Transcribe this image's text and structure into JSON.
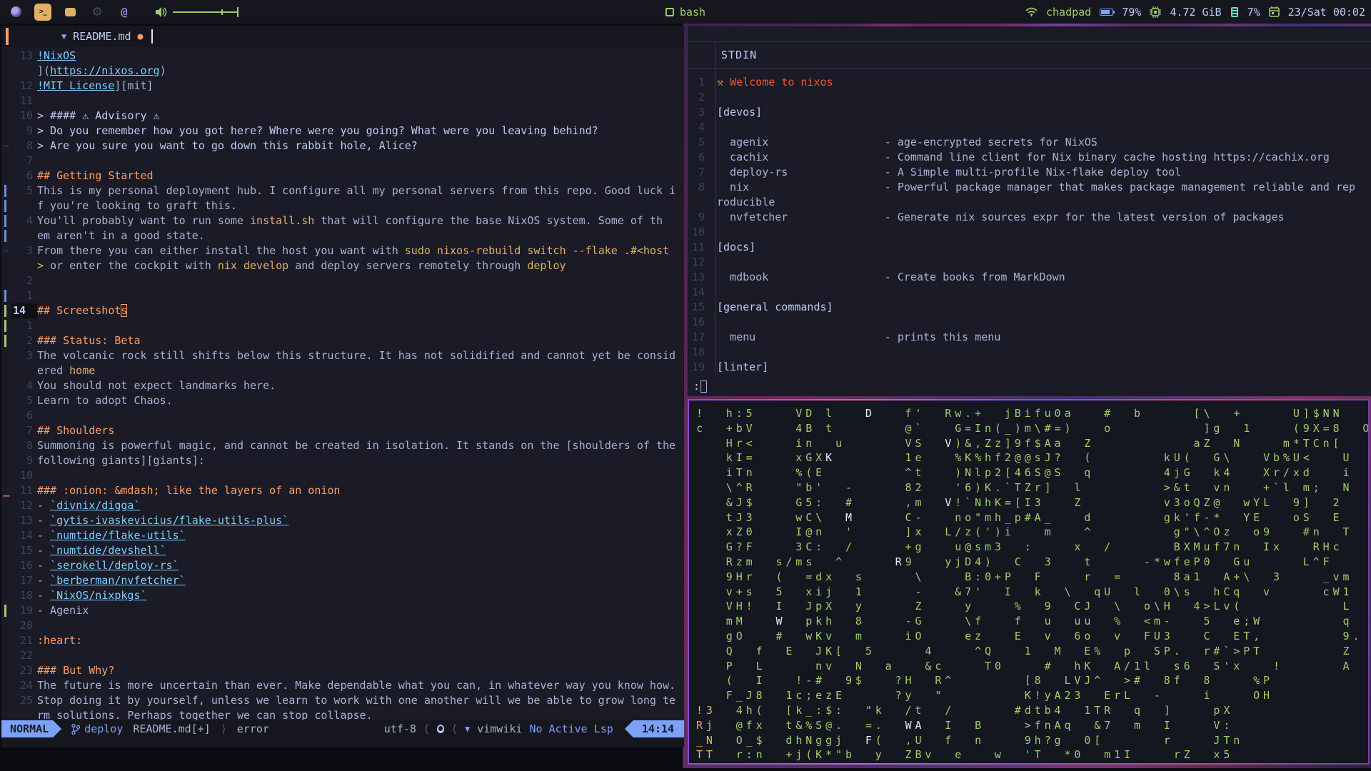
{
  "colors": {
    "bg": "#1a1b26",
    "bg_dark": "#16161e",
    "fg": "#a9b1d6",
    "fg_bright": "#c0caf5",
    "dim": "#3b4261",
    "blue": "#7aa2f7",
    "cyan": "#7dcfff",
    "green": "#9ece6a",
    "orange": "#ff9e64",
    "yellow": "#e0af68",
    "red": "#f7768e",
    "matrix_green": "#9ece6a"
  },
  "topbar": {
    "icons": [
      "firefox",
      "terminal",
      "chat",
      "settings",
      "mentions",
      "volume",
      "wifi",
      "battery",
      "cpu-chip",
      "memory",
      "calendar"
    ],
    "active_workspace": "terminal",
    "window_title": "bash",
    "user": "chadpad",
    "battery": "79%",
    "memory": "4.72 GiB",
    "cpu": "7%",
    "clock": "23/Sat 00:02"
  },
  "editor": {
    "tab": {
      "icon": "markdown",
      "name": "README.md",
      "modified": true
    },
    "lines": [
      {
        "n": "13",
        "sign": "",
        "segs": [
          [
            "!NixOS",
            "link"
          ]
        ]
      },
      {
        "n": "",
        "sign": "",
        "segs": [
          [
            "](",
            "fg"
          ],
          [
            "https://nixos.org",
            "link"
          ],
          [
            ")",
            "fg"
          ]
        ]
      },
      {
        "n": "12",
        "sign": "",
        "segs": [
          [
            "!MIT License",
            "link"
          ],
          [
            "][mit]",
            "fg"
          ]
        ]
      },
      {
        "n": "11",
        "sign": "",
        "segs": []
      },
      {
        "n": "10",
        "sign": "",
        "segs": [
          [
            "> #### ⚠ Advisory ⚠",
            "bright"
          ]
        ]
      },
      {
        "n": "9",
        "sign": "",
        "segs": [
          [
            "> Do you remember how you got here? Where were you going? What were you leaving behind?",
            "bright"
          ]
        ]
      },
      {
        "n": "8",
        "sign": "~",
        "segs": [
          [
            "> Are you sure you want to go down this rabbit hole, Alice?",
            "bright"
          ]
        ]
      },
      {
        "n": "7",
        "sign": "",
        "segs": []
      },
      {
        "n": "6",
        "sign": "",
        "segs": [
          [
            "## Getting Started",
            "h"
          ]
        ]
      },
      {
        "n": "5",
        "sign": "chg",
        "segs": [
          [
            "This is my personal deployment hub. I configure all my personal servers from this repo. Good luck i",
            "fg"
          ]
        ]
      },
      {
        "n": "",
        "sign": "chg",
        "segs": [
          [
            "f you're looking to graft this.",
            "fg"
          ]
        ]
      },
      {
        "n": "4",
        "sign": "chg",
        "segs": [
          [
            "You'll probably want to run some ",
            "fg"
          ],
          [
            "install.sh",
            "code"
          ],
          [
            " that will configure the base NixOS system. Some of th",
            "fg"
          ]
        ]
      },
      {
        "n": "",
        "sign": "chg",
        "segs": [
          [
            "em aren't in a good state.",
            "fg"
          ]
        ]
      },
      {
        "n": "3",
        "sign": "~",
        "segs": [
          [
            "From there you can either install the host you want with ",
            "fg"
          ],
          [
            "sudo nixos-rebuild switch --flake .#<host",
            "code"
          ]
        ]
      },
      {
        "n": "",
        "sign": "",
        "segs": [
          [
            ">",
            "code"
          ],
          [
            " or enter the cockpit with ",
            "fg"
          ],
          [
            "nix develop",
            "code"
          ],
          [
            " and deploy servers remotely through ",
            "fg"
          ],
          [
            "deploy",
            "code"
          ]
        ]
      },
      {
        "n": "2",
        "sign": "",
        "segs": []
      },
      {
        "n": "1",
        "sign": "chg",
        "segs": []
      },
      {
        "n": "14",
        "sign": "add",
        "current": true,
        "segs": [
          [
            "## Screetshot",
            "h"
          ],
          [
            "s",
            "cursorh"
          ]
        ]
      },
      {
        "n": "1",
        "sign": "add",
        "segs": []
      },
      {
        "n": "2",
        "sign": "add",
        "segs": [
          [
            "### Status: Beta",
            "h"
          ]
        ]
      },
      {
        "n": "3",
        "sign": "",
        "segs": [
          [
            "The volcanic rock still shifts below this structure. It has not solidified and cannot yet be consid",
            "fg"
          ]
        ]
      },
      {
        "n": "",
        "sign": "",
        "segs": [
          [
            "ered ",
            "fg"
          ],
          [
            "home",
            "code"
          ]
        ]
      },
      {
        "n": "4",
        "sign": "",
        "segs": [
          [
            "You should not expect landmarks here.",
            "fg"
          ]
        ]
      },
      {
        "n": "5",
        "sign": "",
        "segs": [
          [
            "Learn to adopt Chaos.",
            "fg"
          ]
        ]
      },
      {
        "n": "6",
        "sign": "",
        "segs": []
      },
      {
        "n": "7",
        "sign": "",
        "segs": [
          [
            "## Shoulders",
            "h"
          ]
        ]
      },
      {
        "n": "8",
        "sign": "",
        "segs": [
          [
            "Summoning is powerful magic, and cannot be created in isolation. It stands on the [shoulders of the",
            "fg"
          ]
        ]
      },
      {
        "n": "9",
        "sign": "",
        "segs": [
          [
            "following giants][giants]:",
            "fg"
          ]
        ]
      },
      {
        "n": "10",
        "sign": "",
        "segs": []
      },
      {
        "n": "11",
        "sign": "del",
        "segs": [
          [
            "### :onion: &mdash; like the layers of an onion",
            "h"
          ]
        ]
      },
      {
        "n": "12",
        "sign": "",
        "segs": [
          [
            "- ",
            "fg"
          ],
          [
            "`divnix/digga`",
            "link"
          ]
        ]
      },
      {
        "n": "13",
        "sign": "",
        "segs": [
          [
            "- ",
            "fg"
          ],
          [
            "`gytis-ivaskevicius/flake-utils-plus`",
            "link"
          ]
        ]
      },
      {
        "n": "14",
        "sign": "",
        "segs": [
          [
            "- ",
            "fg"
          ],
          [
            "`numtide/flake-utils`",
            "link"
          ]
        ]
      },
      {
        "n": "15",
        "sign": "",
        "segs": [
          [
            "- ",
            "fg"
          ],
          [
            "`numtide/devshell`",
            "link"
          ]
        ]
      },
      {
        "n": "16",
        "sign": "",
        "segs": [
          [
            "- ",
            "fg"
          ],
          [
            "`serokell/deploy-rs`",
            "link"
          ]
        ]
      },
      {
        "n": "17",
        "sign": "",
        "segs": [
          [
            "- ",
            "fg"
          ],
          [
            "`berberman/nvfetcher`",
            "link"
          ]
        ]
      },
      {
        "n": "18",
        "sign": "",
        "segs": [
          [
            "- ",
            "fg"
          ],
          [
            "`NixOS/nixpkgs`",
            "link"
          ]
        ]
      },
      {
        "n": "19",
        "sign": "add",
        "segs": [
          [
            "- Agenix",
            "fg"
          ]
        ]
      },
      {
        "n": "20",
        "sign": "",
        "segs": []
      },
      {
        "n": "21",
        "sign": "",
        "segs": [
          [
            ":heart:",
            "h"
          ]
        ]
      },
      {
        "n": "22",
        "sign": "",
        "segs": []
      },
      {
        "n": "23",
        "sign": "",
        "segs": [
          [
            "### But Why?",
            "h"
          ]
        ]
      },
      {
        "n": "24",
        "sign": "",
        "segs": [
          [
            "The future is more uncertain than ever. Make dependable what you can, in whatever way you know how.",
            "fg"
          ]
        ]
      },
      {
        "n": "25",
        "sign": "",
        "segs": [
          [
            "Stop doing it by yourself, unless we learn to work with one another will we be able to grow long te",
            "fg"
          ]
        ]
      },
      {
        "n": "",
        "sign": "",
        "segs": [
          [
            "rm solutions. Perhaps together we can stop collapse.",
            "fg"
          ]
        ]
      }
    ],
    "statusline": {
      "mode": "NORMAL",
      "branch": "deploy",
      "file": "README.md[+]",
      "sep_right": "⟩",
      "sep_left": "⟨",
      "diagnostic": "error",
      "encoding": "utf-8",
      "filetype": "vimwiki",
      "lsp": "No Active Lsp",
      "time": "14:14"
    }
  },
  "terminal": {
    "title": "STDIN",
    "prompt": ":",
    "lines": [
      {
        "n": "1",
        "segs": [
          [
            "⚒ ",
            "hammer"
          ],
          [
            "Welcome to nixos",
            "welcome"
          ]
        ]
      },
      {
        "n": "2",
        "segs": []
      },
      {
        "n": "3",
        "segs": [
          [
            "[devos]",
            "bright"
          ]
        ]
      },
      {
        "n": "4",
        "segs": []
      },
      {
        "n": "5",
        "segs": [
          [
            "  agenix                  - age-encrypted secrets for NixOS",
            "fg"
          ]
        ]
      },
      {
        "n": "6",
        "segs": [
          [
            "  cachix                  - Command line client for Nix binary cache hosting https://cachix.org",
            "fg"
          ]
        ]
      },
      {
        "n": "7",
        "segs": [
          [
            "  deploy-rs               - A Simple multi-profile Nix-flake deploy tool",
            "fg"
          ]
        ]
      },
      {
        "n": "8",
        "segs": [
          [
            "  nix                     - Powerful package manager that makes package management reliable and rep",
            "fg"
          ]
        ]
      },
      {
        "n": "",
        "segs": [
          [
            "roducible",
            "fg"
          ]
        ]
      },
      {
        "n": "9",
        "segs": [
          [
            "  nvfetcher               - Generate nix sources expr for the latest version of packages",
            "fg"
          ]
        ]
      },
      {
        "n": "10",
        "segs": []
      },
      {
        "n": "11",
        "segs": [
          [
            "[docs]",
            "bright"
          ]
        ]
      },
      {
        "n": "12",
        "segs": []
      },
      {
        "n": "13",
        "segs": [
          [
            "  mdbook                  - Create books from MarkDown",
            "fg"
          ]
        ]
      },
      {
        "n": "14",
        "segs": []
      },
      {
        "n": "15",
        "segs": [
          [
            "[general commands]",
            "bright"
          ]
        ]
      },
      {
        "n": "16",
        "segs": []
      },
      {
        "n": "17",
        "segs": [
          [
            "  menu                    - prints this menu",
            "fg"
          ]
        ]
      },
      {
        "n": "18",
        "segs": []
      },
      {
        "n": "19",
        "segs": [
          [
            "[linter]",
            "bright"
          ]
        ]
      }
    ]
  },
  "matrix": {
    "rows": [
      [
        [
          "!  h:5    VD l   ",
          "g"
        ],
        [
          "D",
          "w"
        ],
        [
          "   f'  Rw.+  jBifu0a   #  b     [\\  +     U]$NN",
          "g"
        ]
      ],
      [
        [
          "c  +bV    4B t       @`   G=In(_)m\\#=)   o         ]g  1    (9X=8  O",
          "g"
        ]
      ],
      [
        [
          "   Hr<    in  u      VS  ",
          "g"
        ],
        [
          "V",
          "w"
        ],
        [
          ")&,Zz]9f$Aa  Z          aZ  N    m*TCn[",
          "g"
        ]
      ],
      [
        [
          "   kI=    xGX",
          "g"
        ],
        [
          "K",
          "w"
        ],
        [
          "       1e   %K%hf2@@sJ?  (       kU(  G\\   Vb%U<   U",
          "g"
        ]
      ],
      [
        [
          "   iTn    %(E        ^t   )Nlp2[46S@S  q       4jG  k4   Xr/xd   i",
          "g"
        ]
      ],
      [
        [
          "   \\^R    \"b'  -     82   '6)K.`TZr]  l        >&t  vn   +`l m;  N",
          "g"
        ]
      ],
      [
        [
          "   &J$    G5:  #     ,m  ",
          "g"
        ],
        [
          "V",
          "w"
        ],
        [
          "!`NhK=[I3   Z        v3oQZ@  wYL  9]  2",
          "g"
        ]
      ],
      [
        [
          "   tJ3    wC\\  ",
          "g"
        ],
        [
          "M",
          "w"
        ],
        [
          "     C-   no\"mh_p#A_   d       gk'f-*  YE   oS  E",
          "g"
        ]
      ],
      [
        [
          "   xZ0    I@n  '     ]x  L/z(')i   m   ^        g\"\\^Oz  o9   #n  T",
          "g"
        ]
      ],
      [
        [
          "   G?F    3C:  /     +g   u@sm3  :    x  /      BXMuf7n  Ix   RHc",
          "g"
        ]
      ],
      [
        [
          "   Rzm  s/ms  ^     ",
          "g"
        ],
        [
          "R",
          "w"
        ],
        [
          "9   yjD4)  C  3   t     -*wfeP0  Gu     L^F",
          "g"
        ]
      ],
      [
        [
          "   9Hr  (  =dx  s     \\    B:0+P  F    r  =     8a1  A+\\  3    _vm",
          "g"
        ]
      ],
      [
        [
          "   v+s  5  xij  1     -   &7'  I  k  \\  qU  l  0\\s  hCq  v     cW1",
          "g"
        ]
      ],
      [
        [
          "   VH!  I  JpX  y     Z    y    %  9  CJ  \\  o\\H  4>Lv(          L",
          "g"
        ]
      ],
      [
        [
          "   mM   ",
          "g"
        ],
        [
          "W",
          "w"
        ],
        [
          "  pkh  8    -G    \\f   f  u  uu  %  <m-   5  e;W        q",
          "g"
        ]
      ],
      [
        [
          "   gO   #  wKv  m    iO    ez   E  v  6o  v  FU3   C  ET,        9.",
          "g"
        ]
      ],
      [
        [
          "   Q  f  E  JK[  5     4    ^Q   1  M  E%  p  SP.  r#`>PT        Z",
          "g"
        ]
      ],
      [
        [
          "   P  L     nv  N  a   &c    T0    #  hK  A/1l  s6  S'x   !      A",
          "g"
        ]
      ],
      [
        [
          "   (  I   !-#  9$   ?H  R^       [8  LVJ^  >#  8f  8    %P",
          "g"
        ]
      ],
      [
        [
          "   F_J8  1c;ezE     ?y  \"        K!yA23  ErL  -    i    OH",
          "g"
        ]
      ],
      [
        [
          "!3",
          "y"
        ],
        [
          "  4h(  [k_:$:  \"k  /t  /      #dtb4  1TR  q  ]    pX",
          "g"
        ]
      ],
      [
        [
          "Rj",
          "y"
        ],
        [
          "  @fx  t&%S@.  =.  ",
          "g"
        ],
        [
          "WA",
          "w"
        ],
        [
          "  I  B    >fnAq  &7  m  I    V:",
          "g"
        ]
      ],
      [
        [
          "_N",
          "y"
        ],
        [
          "  O_$  dhNggj  ",
          "g"
        ],
        [
          "F",
          "w"
        ],
        [
          "(  ,U  f  n    9h?g  0[      r    JTn",
          "g"
        ]
      ],
      [
        [
          "TT",
          "y"
        ],
        [
          "  r:n  +j(K*\"b  y  ZBv  e   w  'T  *0  m1I    rZ  x5",
          "g"
        ]
      ]
    ]
  }
}
